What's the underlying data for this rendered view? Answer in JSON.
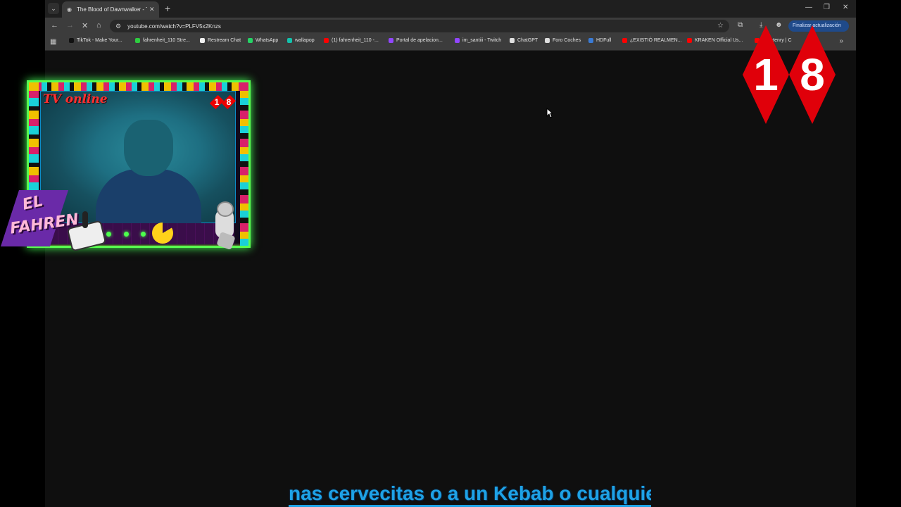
{
  "browser": {
    "tab": {
      "title": "The Blood of Dawnwalker - Trái"
    },
    "address": {
      "url": "youtube.com/watch?v=PLFV5x2Knzs"
    },
    "update_button": "Finalizar actualización",
    "bookmarks": [
      {
        "label": "TikTok - Make Your...",
        "color": "#111111"
      },
      {
        "label": "fahrenheit_110 Stre...",
        "color": "#2ecc40"
      },
      {
        "label": "Restream Chat",
        "color": "#f0f0f0"
      },
      {
        "label": "WhatsApp",
        "color": "#25d366"
      },
      {
        "label": "wallapop",
        "color": "#13c1ac"
      },
      {
        "label": "(1) fahrenheit_110 -...",
        "color": "#ff0000"
      },
      {
        "label": "Portal de apelacion...",
        "color": "#9146ff"
      },
      {
        "label": "im_santiii - Twitch",
        "color": "#9146ff"
      },
      {
        "label": "ChatGPT",
        "color": "#e0e0e0"
      },
      {
        "label": "Foro Coches",
        "color": "#dddddd"
      },
      {
        "label": "HDFull",
        "color": "#3a7bd5"
      },
      {
        "label": "¿EXISTIÓ REALMEN...",
        "color": "#ff0000"
      },
      {
        "label": "KRAKEN Official Us...",
        "color": "#ff0000"
      },
      {
        "label": "ore Henry | C",
        "color": "#ff0000"
      }
    ]
  },
  "overlay": {
    "cam_title": "TV online",
    "small_badge": [
      "1",
      "8"
    ],
    "streamer_tag_line1": "EL",
    "streamer_tag_line2": "FAHREN",
    "age_rating": [
      "1",
      "8"
    ]
  },
  "subtitle": "nas cervecitas o a un Kebab o cualquier c",
  "colors": {
    "accent_blue": "#1ea2e6",
    "frame_green": "#59ff4f",
    "badge_red": "#e0000a"
  }
}
